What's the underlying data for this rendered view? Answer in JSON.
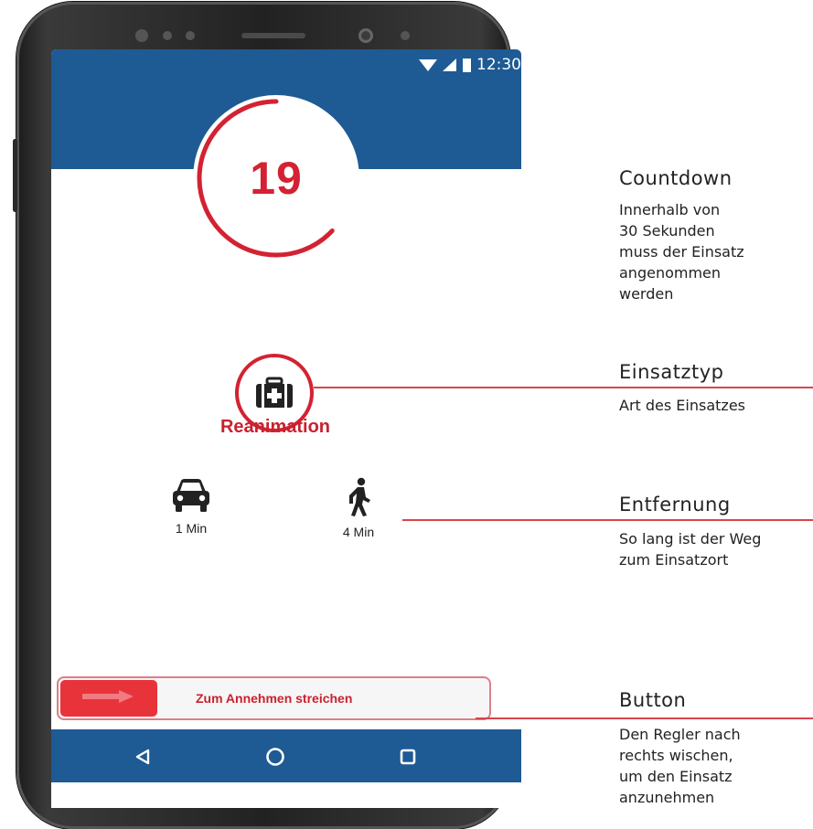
{
  "status_bar": {
    "time": "12:30"
  },
  "countdown": {
    "value": "19",
    "total_seconds": 30,
    "remaining_fraction": 0.63,
    "color": "#d32232"
  },
  "incident": {
    "type_label": "Reanimation",
    "icon": "first-aid-kit-icon"
  },
  "distances": [
    {
      "mode": "car",
      "icon": "car-icon",
      "label": "1 Min"
    },
    {
      "mode": "walk",
      "icon": "walking-person-icon",
      "label": "4 Min"
    }
  ],
  "slider": {
    "label": "Zum Annehmen streichen",
    "handle_icon": "arrow-right-icon",
    "handle_color": "#e8333b"
  },
  "navbar": {
    "back_icon": "back-triangle-icon",
    "home_icon": "home-circle-icon",
    "recents_icon": "recents-square-icon",
    "color": "#1e5a93"
  },
  "annotations": {
    "countdown": {
      "title": "Countdown",
      "lines": [
        "Innerhalb von",
        "30 Sekunden",
        "muss der Einsatz",
        "angenommen",
        "werden"
      ]
    },
    "type": {
      "title": "Einsatztyp",
      "lines": [
        "Art des Einsatzes"
      ]
    },
    "distance": {
      "title": "Entfernung",
      "lines": [
        "So lang ist der Weg",
        "zum Einsatzort"
      ]
    },
    "button": {
      "title": "Button",
      "lines": [
        "Den Regler nach",
        "rechts wischen,",
        "um den Einsatz",
        "anzunehmen"
      ]
    }
  }
}
